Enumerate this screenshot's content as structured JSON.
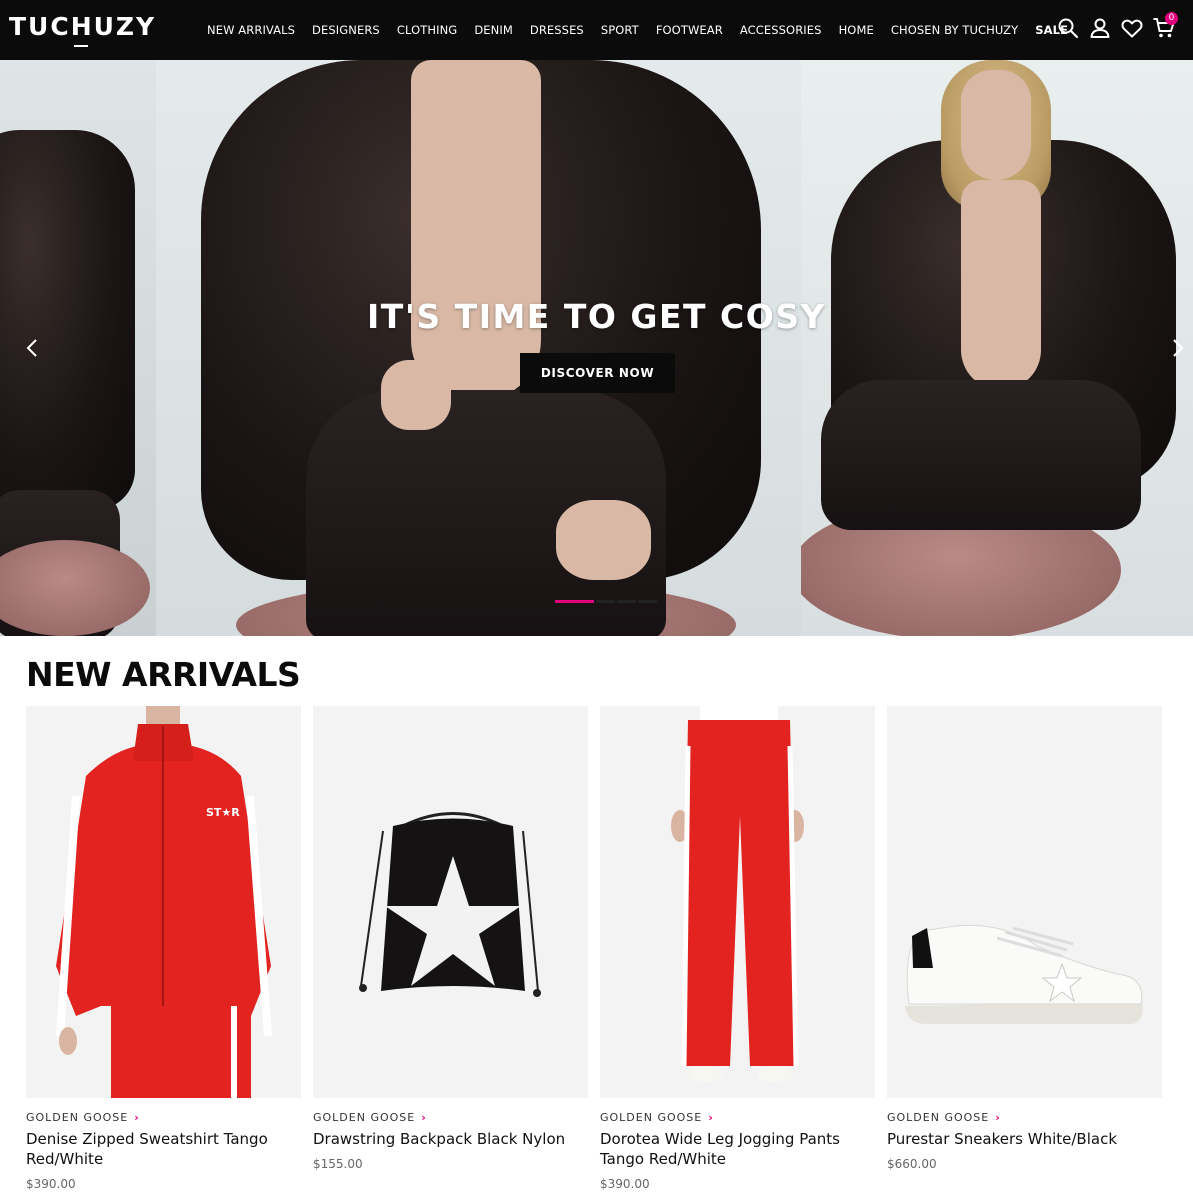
{
  "header": {
    "logo": "TUCHUZY",
    "nav": [
      {
        "label": "NEW ARRIVALS"
      },
      {
        "label": "DESIGNERS"
      },
      {
        "label": "CLOTHING"
      },
      {
        "label": "DENIM"
      },
      {
        "label": "DRESSES"
      },
      {
        "label": "SPORT"
      },
      {
        "label": "FOOTWEAR"
      },
      {
        "label": "ACCESSORIES"
      },
      {
        "label": "HOME"
      },
      {
        "label": "CHOSEN BY TUCHUZY"
      },
      {
        "label": "SALE"
      }
    ],
    "icons": [
      "search-icon",
      "account-icon",
      "wishlist-icon",
      "cart-icon"
    ],
    "cart_count": "0"
  },
  "hero": {
    "title": "IT'S TIME TO GET COSY",
    "cta": "DISCOVER NOW",
    "slides_total": 4,
    "active_slide": 1
  },
  "new_arrivals": {
    "title": "NEW ARRIVALS",
    "products": [
      {
        "brand": "GOLDEN GOOSE",
        "name": "Denise Zipped Sweatshirt Tango Red/White",
        "price": "$390.00"
      },
      {
        "brand": "GOLDEN GOOSE",
        "name": "Drawstring Backpack Black Nylon",
        "price": "$155.00"
      },
      {
        "brand": "GOLDEN GOOSE",
        "name": "Dorotea Wide Leg Jogging Pants Tango Red/White",
        "price": "$390.00"
      },
      {
        "brand": "GOLDEN GOOSE",
        "name": "Purestar Sneakers White/Black",
        "price": "$660.00"
      }
    ]
  },
  "colors": {
    "accent": "#e4007c",
    "header_bg": "#0b0b0b",
    "product_red": "#e3231f"
  }
}
